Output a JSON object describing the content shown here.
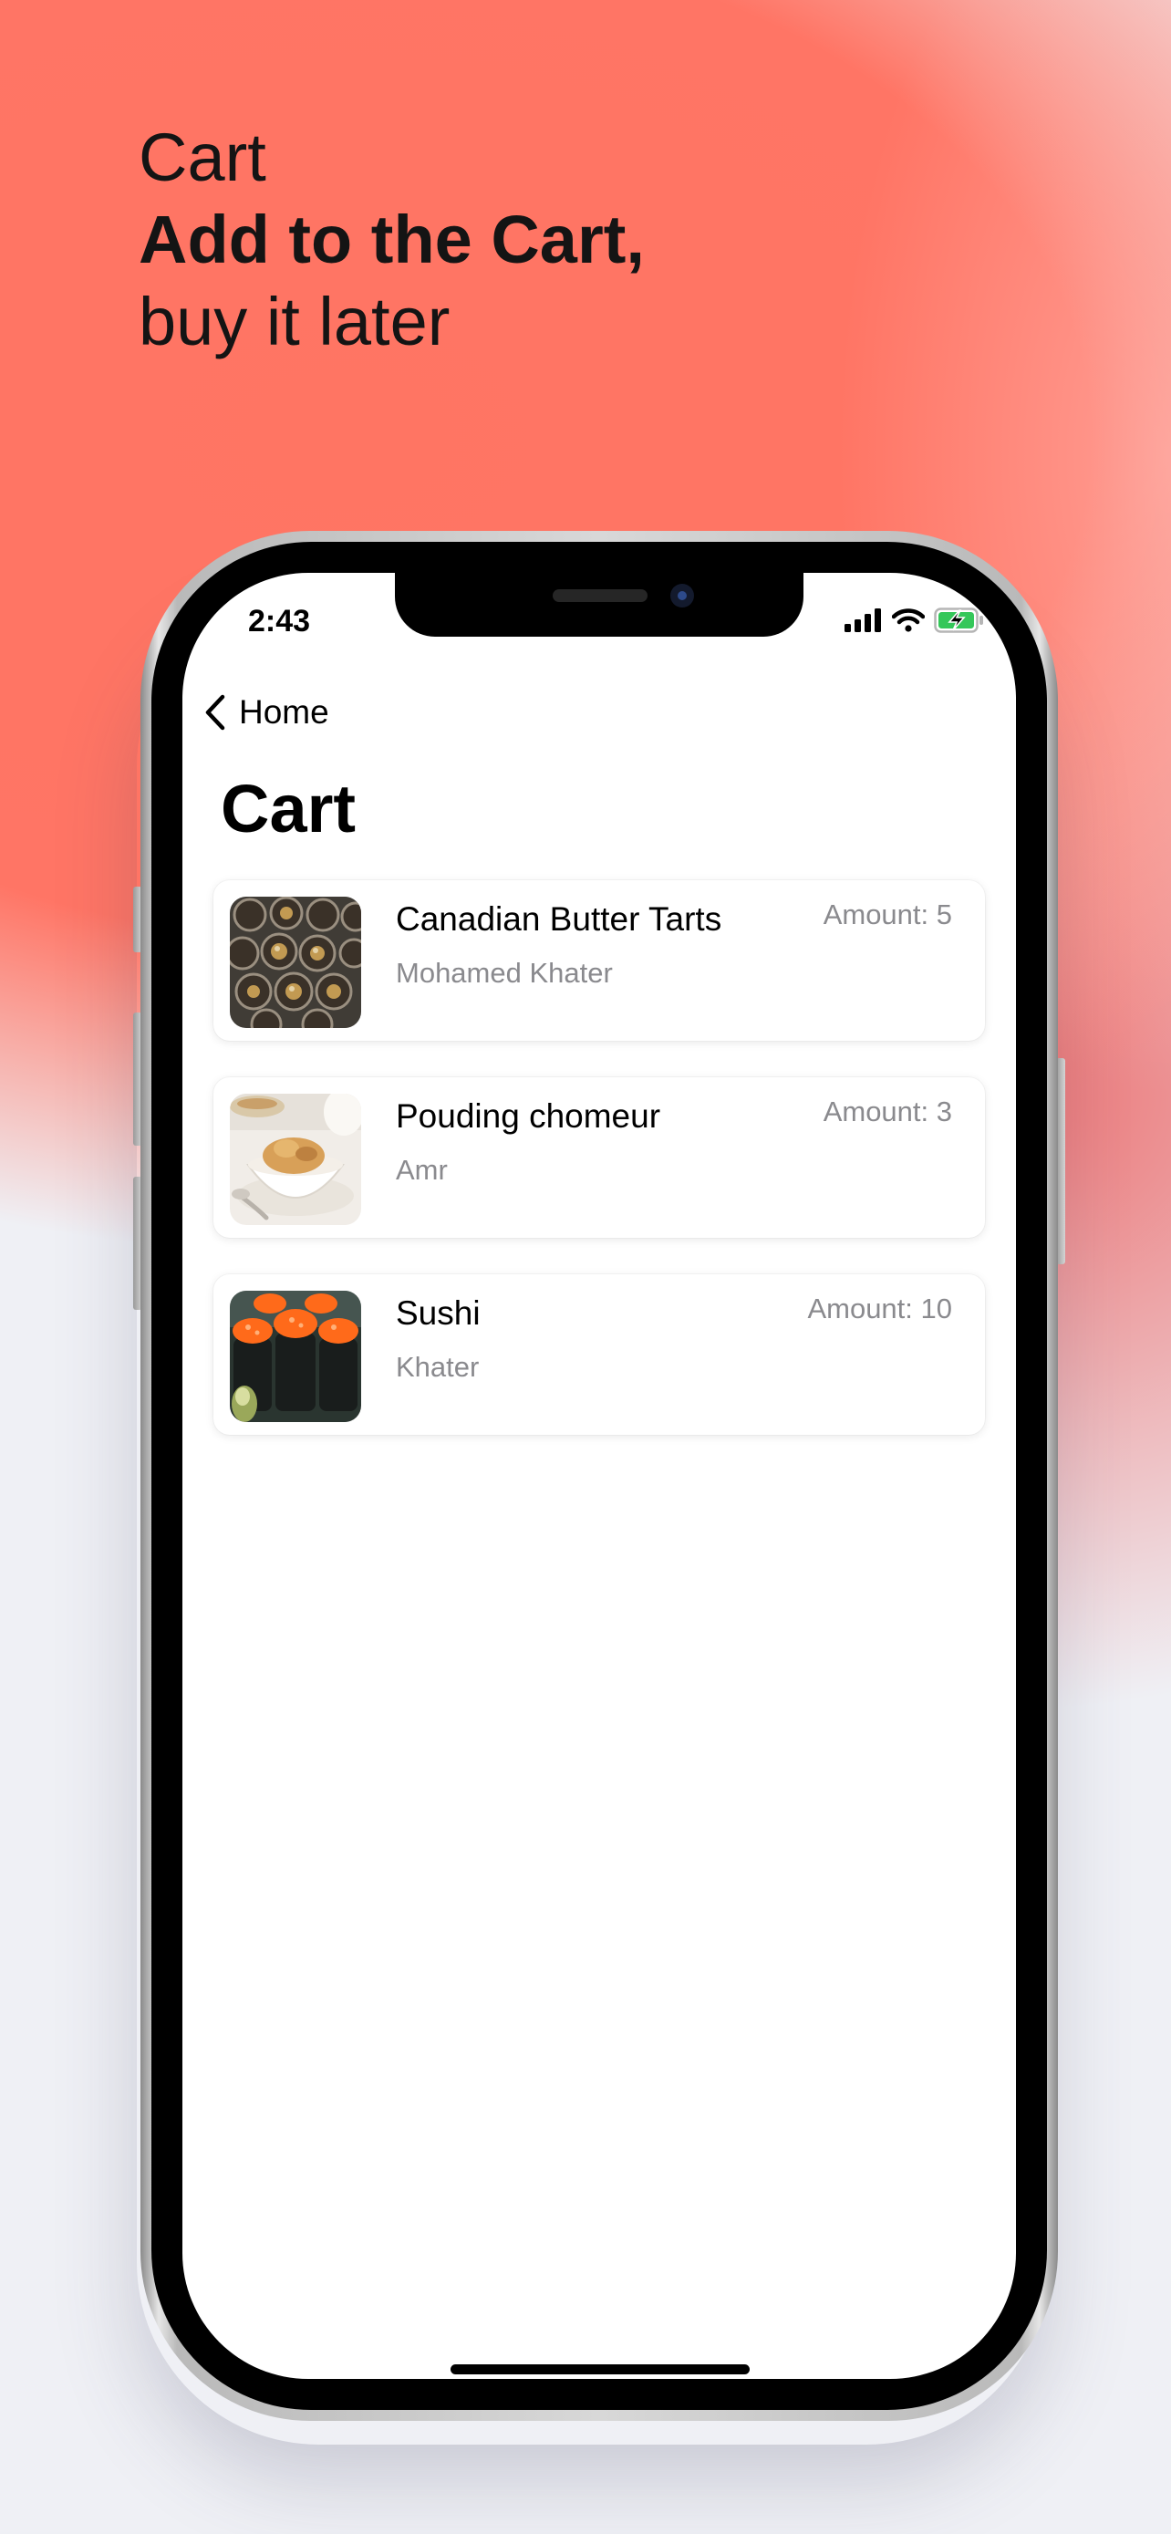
{
  "promo": {
    "line1": "Cart",
    "line2": "Add to the Cart,",
    "line3": "buy it later"
  },
  "status_bar": {
    "time": "2:43"
  },
  "nav": {
    "back_label": "Home"
  },
  "page": {
    "title": "Cart"
  },
  "cart": {
    "items": [
      {
        "name": "Canadian Butter Tarts",
        "author": "Mohamed Khater",
        "amount": "Amount: 5"
      },
      {
        "name": "Pouding chomeur",
        "author": "Amr",
        "amount": "Amount: 3"
      },
      {
        "name": "Sushi",
        "author": "Khater",
        "amount": "Amount: 10"
      }
    ]
  },
  "colors": {
    "background_accent": "#ff7563",
    "battery": "#34c759",
    "secondary_text": "#8a8a8e"
  },
  "icons": [
    "chevron-left-icon",
    "signal-icon",
    "wifi-icon",
    "battery-charging-icon"
  ]
}
